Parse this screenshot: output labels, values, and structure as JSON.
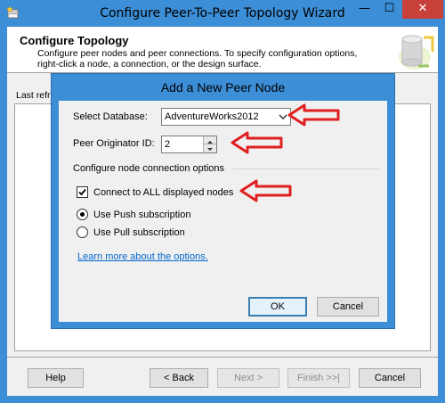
{
  "wizard": {
    "title": "Configure Peer-To-Peer Topology Wizard",
    "header_title": "Configure Topology",
    "header_desc": "Configure peer nodes and peer connections. To specify configuration options, right-click a node, a connection, or the design surface.",
    "toolbar_label": "Last refre",
    "buttons": {
      "help": "Help",
      "back": "< Back",
      "next": "Next >",
      "finish": "Finish >>|",
      "cancel": "Cancel"
    },
    "title_buttons": {
      "minimize": "—",
      "maximize": "☐",
      "close": "✕"
    }
  },
  "dialog": {
    "title": "Add a New Peer Node",
    "select_database_label": "Select Database:",
    "select_database_value": "AdventureWorks2012",
    "peer_originator_label": "Peer Originator ID:",
    "peer_originator_value": "2",
    "group_label": "Configure node connection options",
    "connect_all_label": "Connect to ALL displayed nodes",
    "connect_all_checked": true,
    "subscription_options": [
      {
        "label": "Use Push subscription",
        "selected": true
      },
      {
        "label": "Use Pull subscription",
        "selected": false
      }
    ],
    "learn_more_link": "Learn more about the options.",
    "ok_label": "OK",
    "cancel_label": "Cancel"
  },
  "colors": {
    "titlebar": "#3c8ed6",
    "close": "#c7403a",
    "callout": "#e02020",
    "link": "#0066cc"
  }
}
